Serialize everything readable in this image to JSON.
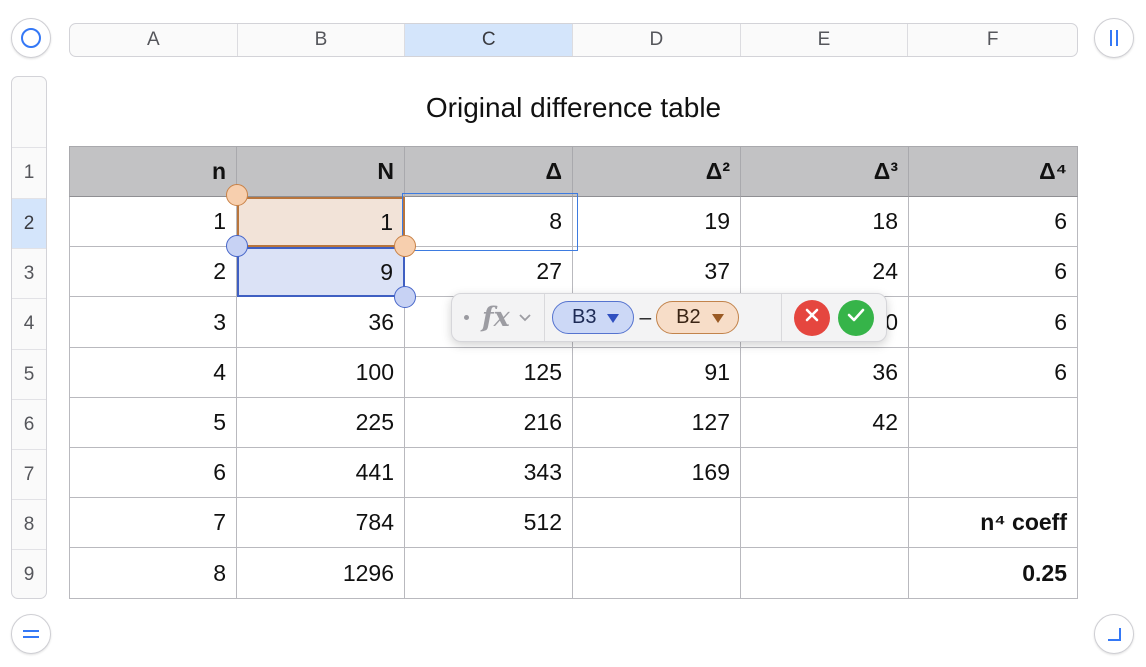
{
  "sheet": {
    "columns": [
      "A",
      "B",
      "C",
      "D",
      "E",
      "F"
    ],
    "selected_column": "C",
    "rows": [
      "1",
      "2",
      "3",
      "4",
      "5",
      "6",
      "7",
      "8",
      "9"
    ],
    "selected_row": "2"
  },
  "table": {
    "title": "Original difference table",
    "header": [
      "n",
      "N",
      "Δ",
      "Δ²",
      "Δ³",
      "Δ⁴"
    ],
    "body": [
      [
        "1",
        "1",
        "8",
        "19",
        "18",
        "6"
      ],
      [
        "2",
        "9",
        "27",
        "37",
        "24",
        "6"
      ],
      [
        "3",
        "36",
        "",
        "",
        "0",
        "6"
      ],
      [
        "4",
        "100",
        "125",
        "91",
        "36",
        "6"
      ],
      [
        "5",
        "225",
        "216",
        "127",
        "42",
        ""
      ],
      [
        "6",
        "441",
        "343",
        "169",
        "",
        ""
      ],
      [
        "7",
        "784",
        "512",
        "",
        "",
        "n⁴ coeff"
      ],
      [
        "8",
        "1296",
        "",
        "",
        "",
        "0.25"
      ]
    ]
  },
  "formula_editor": {
    "function_symbol": "fx",
    "tokens": [
      {
        "ref": "B3",
        "color": "#3f5fc2"
      },
      {
        "ref": "B2",
        "color": "#b8753d"
      }
    ],
    "operator": "–",
    "cancel_label": "cancel",
    "accept_label": "accept"
  },
  "icons": {
    "top_left": "circle-icon",
    "top_right": "pause-bars-icon",
    "bottom_left": "equals-icon",
    "bottom_right": "corner-resize-icon"
  },
  "colors": {
    "selection_blue": "#d4e5fb",
    "reference_orange": "#b8753d",
    "reference_blue": "#3f5fc2",
    "header_gray": "#c2c2c4",
    "cancel_red": "#e5463f",
    "accept_green": "#36b449"
  }
}
